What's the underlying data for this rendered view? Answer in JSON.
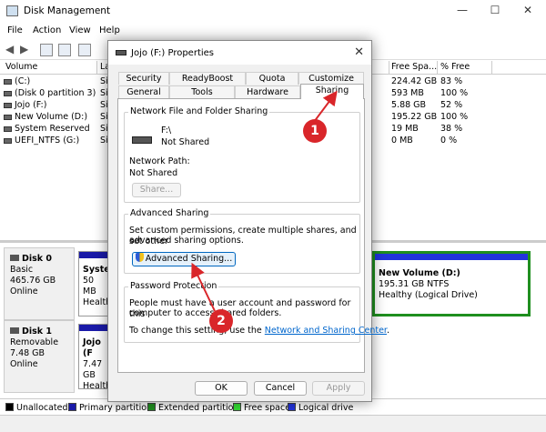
{
  "window": {
    "title": "Disk Management",
    "min": "—",
    "max": "☐",
    "close": "✕"
  },
  "menu": [
    "File",
    "Action",
    "View",
    "Help"
  ],
  "list": {
    "headers": {
      "volume": "Volume",
      "layout": "La",
      "free_space": "Free Spa...",
      "pct_free": "% Free"
    },
    "rows": [
      {
        "volume": "(C:)",
        "layout": "Si",
        "free": "224.42 GB",
        "pct": "83 %"
      },
      {
        "volume": "(Disk 0 partition 3)",
        "layout": "Si",
        "free": "593 MB",
        "pct": "100 %"
      },
      {
        "volume": "Jojo (F:)",
        "layout": "Si",
        "free": "5.88 GB",
        "pct": "52 %"
      },
      {
        "volume": "New Volume (D:)",
        "layout": "Si",
        "free": "195.22 GB",
        "pct": "100 %"
      },
      {
        "volume": "System Reserved",
        "layout": "Si",
        "free": "19 MB",
        "pct": "38 %"
      },
      {
        "volume": "UEFI_NTFS (G:)",
        "layout": "Si",
        "free": "0 MB",
        "pct": "0 %"
      }
    ]
  },
  "disks": [
    {
      "name": "Disk 0",
      "type": "Basic",
      "size": "465.76 GB",
      "status": "Online",
      "part_left": {
        "l1": "Syster",
        "l2": "50 MB",
        "l3": "Health"
      },
      "part_right": {
        "l1": "New Volume  (D:)",
        "l2": "195.31 GB NTFS",
        "l3": "Healthy (Logical Drive)"
      }
    },
    {
      "name": "Disk 1",
      "type": "Removable",
      "size": "7.48 GB",
      "status": "Online",
      "part_left": {
        "l1": "Jojo (F",
        "l2": "7.47 GB",
        "l3": "Health"
      }
    }
  ],
  "legend": [
    {
      "label": "Unallocated",
      "color": "#000000"
    },
    {
      "label": "Primary partition",
      "color": "#1a1aa8"
    },
    {
      "label": "Extended partition",
      "color": "#1f8f1f"
    },
    {
      "label": "Free space",
      "color": "#33dd33"
    },
    {
      "label": "Logical drive",
      "color": "#2233dd"
    }
  ],
  "dialog": {
    "title": "Jojo (F:) Properties",
    "close": "✕",
    "tabs_row1": [
      "Security",
      "ReadyBoost",
      "Quota",
      "Customize"
    ],
    "tabs_row2": [
      "General",
      "Tools",
      "Hardware",
      "Sharing"
    ],
    "sharing": {
      "nff_title": "Network File and Folder Sharing",
      "drive": "F:\\",
      "drive_status": "Not Shared",
      "network_path_label": "Network Path:",
      "network_path_value": "Not Shared",
      "share_button": "Share...",
      "adv_title": "Advanced Sharing",
      "adv_desc_1": "Set custom permissions, create multiple shares, and set other",
      "adv_desc_2": "advanced sharing options.",
      "adv_button": "Advanced Sharing...",
      "pw_title": "Password Protection",
      "pw_desc_1": "People must have a user account and password for this",
      "pw_desc_2": "computer to access shared folders.",
      "pw_change_prefix": "To change this setting, use the",
      "pw_link": "Network and Sharing Center",
      "pw_change_suffix": "."
    },
    "buttons": {
      "ok": "OK",
      "cancel": "Cancel",
      "apply": "Apply"
    }
  },
  "callouts": [
    "1",
    "2"
  ],
  "colors": {
    "callout": "#d9262a",
    "healthy_border": "#1f8f1f",
    "primary": "#1a1aa8"
  }
}
